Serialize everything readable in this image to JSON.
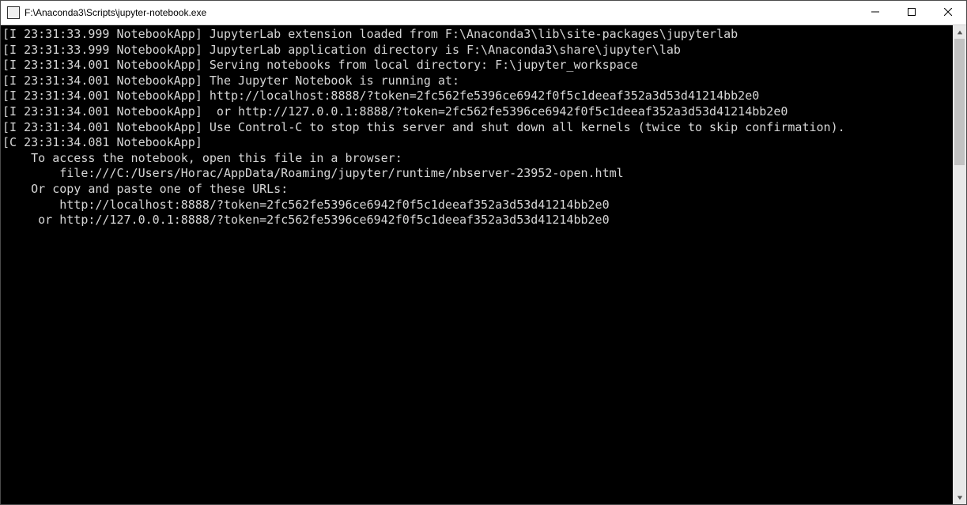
{
  "window": {
    "title": "F:\\Anaconda3\\Scripts\\jupyter-notebook.exe"
  },
  "console": {
    "lines": [
      "[I 23:31:33.999 NotebookApp] JupyterLab extension loaded from F:\\Anaconda3\\lib\\site-packages\\jupyterlab",
      "[I 23:31:33.999 NotebookApp] JupyterLab application directory is F:\\Anaconda3\\share\\jupyter\\lab",
      "[I 23:31:34.001 NotebookApp] Serving notebooks from local directory: F:\\jupyter_workspace",
      "[I 23:31:34.001 NotebookApp] The Jupyter Notebook is running at:",
      "[I 23:31:34.001 NotebookApp] http://localhost:8888/?token=2fc562fe5396ce6942f0f5c1deeaf352a3d53d41214bb2e0",
      "[I 23:31:34.001 NotebookApp]  or http://127.0.0.1:8888/?token=2fc562fe5396ce6942f0f5c1deeaf352a3d53d41214bb2e0",
      "[I 23:31:34.001 NotebookApp] Use Control-C to stop this server and shut down all kernels (twice to skip confirmation).",
      "[C 23:31:34.081 NotebookApp]",
      "",
      "    To access the notebook, open this file in a browser:",
      "        file:///C:/Users/Horac/AppData/Roaming/jupyter/runtime/nbserver-23952-open.html",
      "    Or copy and paste one of these URLs:",
      "        http://localhost:8888/?token=2fc562fe5396ce6942f0f5c1deeaf352a3d53d41214bb2e0",
      "     or http://127.0.0.1:8888/?token=2fc562fe5396ce6942f0f5c1deeaf352a3d53d41214bb2e0"
    ]
  }
}
